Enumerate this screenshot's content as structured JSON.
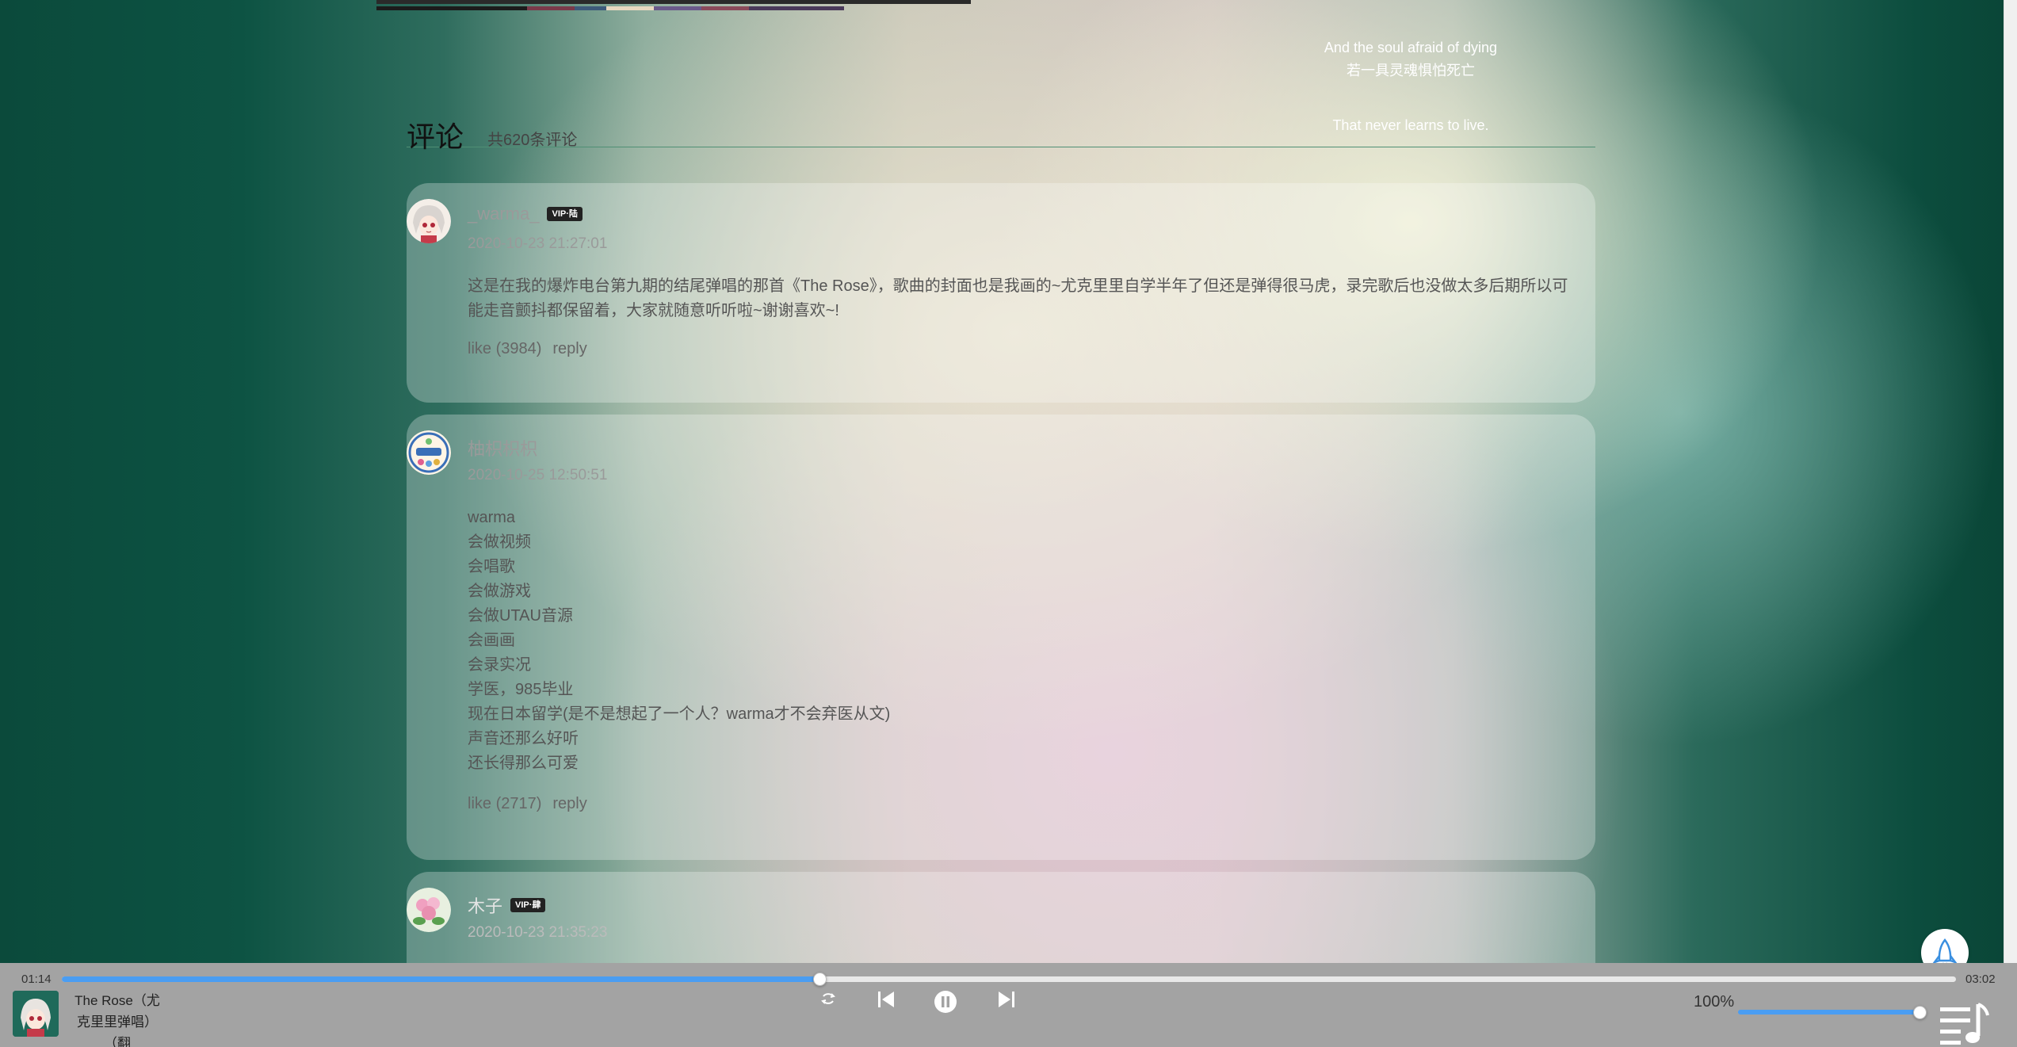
{
  "lyrics": {
    "line1_en": "And the soul afraid of dying",
    "line1_zh": "若一具灵魂惧怕死亡",
    "line2_en": "That never learns to live."
  },
  "comments_section": {
    "title": "评论",
    "count": "共620条评论"
  },
  "comments": [
    {
      "username": "_warma_",
      "badge": "VIP·陆",
      "date": "2020-10-23 21:27:01",
      "text": "这是在我的爆炸电台第九期的结尾弹唱的那首《The Rose》，歌曲的封面也是我画的~尤克里里自学半年了但还是弹得很马虎，录完歌后也没做太多后期所以可能走音颤抖都保留着，大家就随意听听啦~谢谢喜欢~!",
      "like": "like (3984)",
      "reply": "reply"
    },
    {
      "username": "柚枳枳枳",
      "date": "2020-10-25 12:50:51",
      "lines": [
        "warma",
        "会做视频",
        "会唱歌",
        "会做游戏",
        "会做UTAU音源",
        "会画画",
        "会录实况",
        "学医，985毕业",
        "现在日本留学(是不是想起了一个人？warma才不会弃医从文)",
        "声音还那么好听",
        "还长得那么可爱"
      ],
      "like": "like (2717)",
      "reply": "reply"
    },
    {
      "username": "木子",
      "badge": "VIP·肆",
      "date": "2020-10-23 21:35:23"
    }
  ],
  "player": {
    "current_time": "01:14",
    "total_time": "03:02",
    "progress": 0.4,
    "track_title": "The Rose（尤克里里弹唱）（翻",
    "volume_label": "100%",
    "volume": 1.0,
    "accent_color": "#4a9df2"
  }
}
